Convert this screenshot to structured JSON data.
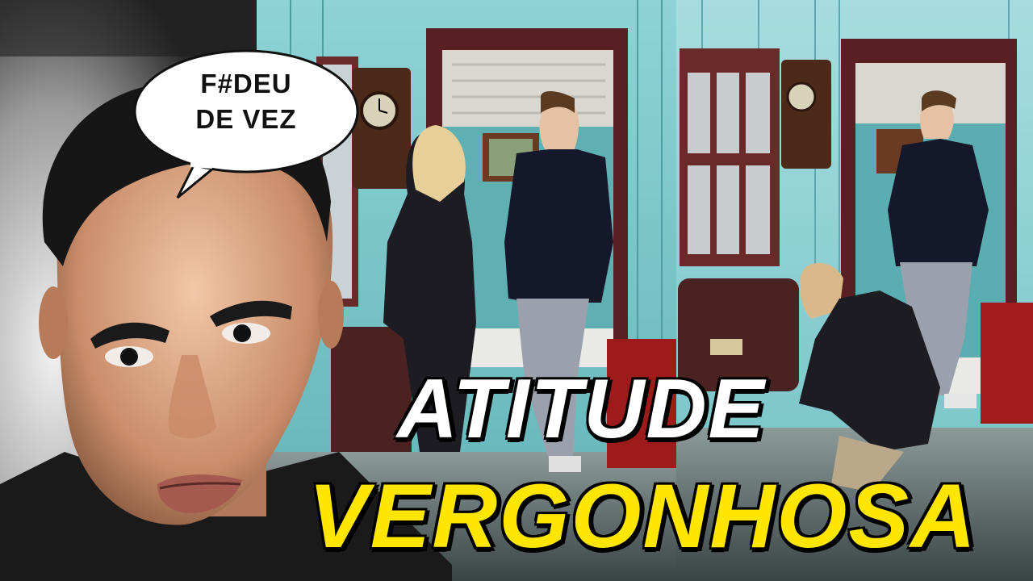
{
  "speech_bubble": {
    "line1": "F#DEU",
    "line2": "DE VEZ"
  },
  "headline": {
    "line1": "ATITUDE",
    "line2": "VERGONHOSA"
  },
  "colors": {
    "headline_line1": "#ffffff",
    "headline_line2": "#ffe600",
    "wall": "#6fc2c6",
    "door_frame": "#5a1f22"
  }
}
